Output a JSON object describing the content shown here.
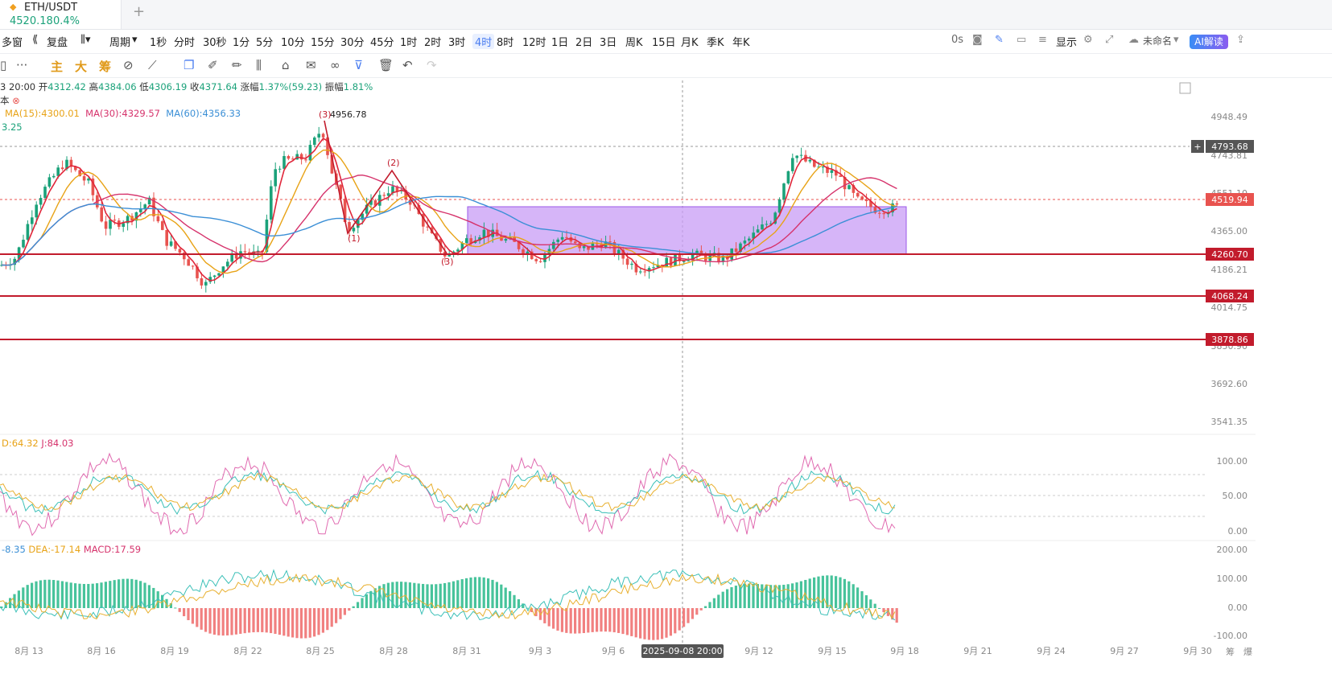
{
  "tab": {
    "pair": "ETH/USDT",
    "price": "4520.18",
    "change": "0.4%",
    "add": "+"
  },
  "toolbar1": {
    "multi": "多窗",
    "replay": "复盘",
    "period_label": "周期",
    "periods": [
      "1秒",
      "分时",
      "30秒",
      "1分",
      "5分",
      "10分",
      "15分",
      "30分",
      "45分",
      "1时",
      "2时",
      "3时",
      "4时",
      "8时",
      "12时",
      "1日",
      "2日",
      "3日",
      "周K",
      "15日",
      "月K",
      "季K",
      "年K"
    ],
    "active_period": "4时",
    "countdown": "0s",
    "display": "显示",
    "layout_name": "未命名",
    "ai": "AI解读"
  },
  "toolbar2": {
    "main": "主",
    "big": "大",
    "chip": "筹"
  },
  "info": {
    "time": "3 20:00",
    "open_label": "开",
    "open": "4312.42",
    "high_label": "高",
    "high": "4384.06",
    "low_label": "低",
    "low": "4306.19",
    "close_label": "收",
    "close": "4371.64",
    "change_label": "涨幅",
    "change": "1.37%(59.23)",
    "amp_label": "振幅",
    "amp": "1.81%",
    "indicator_label": "本",
    "ma15": "MA(15):4300.01",
    "ma30": "MA(30):4329.57",
    "ma60": "MA(60):4356.33",
    "ma_extra": "3.25",
    "kdj_d": "D:64.32",
    "kdj_j": "J:84.03",
    "macd_dif": "-8.35",
    "macd_dea": "DEA:-17.14",
    "macd_val": "MACD:17.59"
  },
  "chart": {
    "price_axis": [
      "4948.49",
      "4743.81",
      "4551.10",
      "4365.00",
      "4186.21",
      "4014.75",
      "3850.90",
      "3692.60",
      "3541.35"
    ],
    "kdj_axis": [
      "100.00",
      "50.00",
      "0.00"
    ],
    "macd_axis": [
      "200.00",
      "100.00",
      "0.00",
      "-100.00"
    ],
    "date_axis": [
      "8月 13",
      "8月 16",
      "8月 19",
      "8月 22",
      "8月 25",
      "8月 28",
      "8月 31",
      "9月 3",
      "9月 6",
      "9月 12",
      "9月 15",
      "9月 18",
      "9月 21",
      "9月 24",
      "9月 27",
      "9月 30"
    ],
    "crosshair_date": "2025-09-08 20:00",
    "crosshair_price": "4793.68",
    "current_price": "4519.94",
    "levels": [
      "4260.70",
      "4068.24",
      "3878.86"
    ],
    "peak_label": "4956.78",
    "wave_labels": [
      "(1)",
      "(2)",
      "(3)"
    ],
    "peak_wave": "(3)",
    "axis_right_bottom": [
      "筹",
      "爆"
    ]
  },
  "colors": {
    "up": "#1ba27a",
    "down": "#e8534f",
    "ma15": "#e8a317",
    "ma30": "#d6336c",
    "ma60": "#3b8fd6",
    "box": "#c89cf6",
    "level": "#c21b2c"
  }
}
